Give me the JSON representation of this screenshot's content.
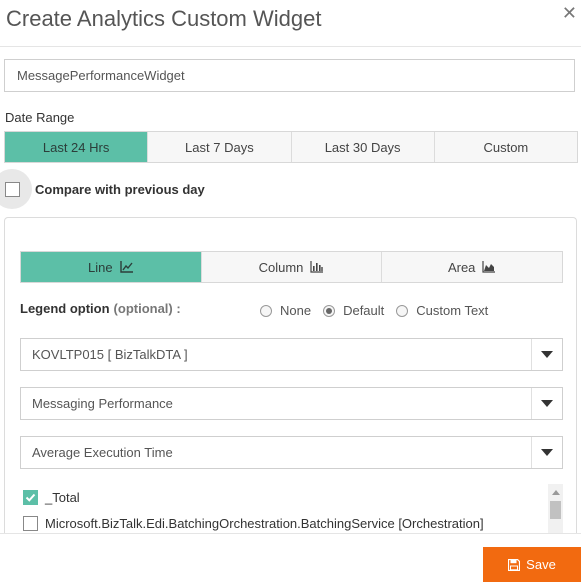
{
  "dialog": {
    "title": "Create Analytics Custom Widget",
    "close_glyph": "✕"
  },
  "widget_name": {
    "value": "MessagePerformanceWidget"
  },
  "date_range": {
    "label": "Date Range",
    "options": [
      {
        "label": "Last 24 Hrs"
      },
      {
        "label": "Last 7 Days"
      },
      {
        "label": "Last 30 Days"
      },
      {
        "label": "Custom"
      }
    ],
    "selected_index": 0
  },
  "compare": {
    "label": "Compare with previous day",
    "checked": false
  },
  "chart_type": {
    "options": [
      {
        "label": "Line",
        "icon": "line-chart-icon"
      },
      {
        "label": "Column",
        "icon": "bar-chart-icon"
      },
      {
        "label": "Area",
        "icon": "area-chart-icon"
      }
    ],
    "selected_index": 0
  },
  "legend": {
    "label": "Legend option",
    "optional": "(optional) :",
    "options": [
      {
        "label": "None"
      },
      {
        "label": "Default"
      },
      {
        "label": "Custom Text"
      }
    ],
    "selected_index": 1
  },
  "selects": {
    "environment": "KOVLTP015 [ BizTalkDTA ]",
    "category": "Messaging Performance",
    "metric": "Average Execution Time"
  },
  "instances": [
    {
      "label": "_Total",
      "checked": true
    },
    {
      "label": "Microsoft.BizTalk.Edi.BatchingOrchestration.BatchingService [Orchestration]",
      "checked": false
    }
  ],
  "footer": {
    "save_label": "Save",
    "save_icon": "floppy-disk-icon"
  },
  "colors": {
    "accent": "#5cbfa7",
    "save": "#f26a10"
  }
}
